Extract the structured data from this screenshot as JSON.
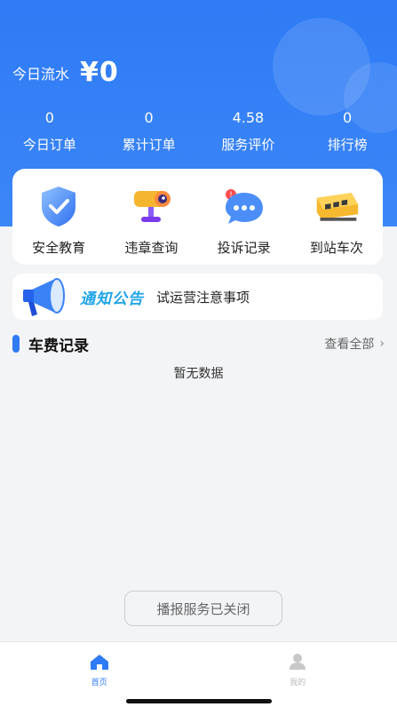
{
  "header": {
    "income_label": "今日流水",
    "income_value": "¥0"
  },
  "stats": [
    {
      "value": "0",
      "label": "今日订单"
    },
    {
      "value": "0",
      "label": "累计订单"
    },
    {
      "value": "4.58",
      "label": "服务评价"
    },
    {
      "value": "0",
      "label": "排行榜"
    }
  ],
  "quick_actions": [
    {
      "label": "安全教育",
      "icon": "shield-check-icon"
    },
    {
      "label": "违章查询",
      "icon": "camera-icon"
    },
    {
      "label": "投诉记录",
      "icon": "chat-bubble-icon"
    },
    {
      "label": "到站车次",
      "icon": "train-icon"
    }
  ],
  "notice": {
    "tag": "通知公告",
    "text": "试运营注意事项"
  },
  "fare_records": {
    "title": "车费记录",
    "view_all": "查看全部",
    "empty_text": "暂无数据"
  },
  "broadcast_button": "播报服务已关闭",
  "tabbar": {
    "home_label": "首页",
    "mine_label": "我的"
  },
  "colors": {
    "primary": "#2f7bf5",
    "notice_tag": "#1fa4e9"
  }
}
